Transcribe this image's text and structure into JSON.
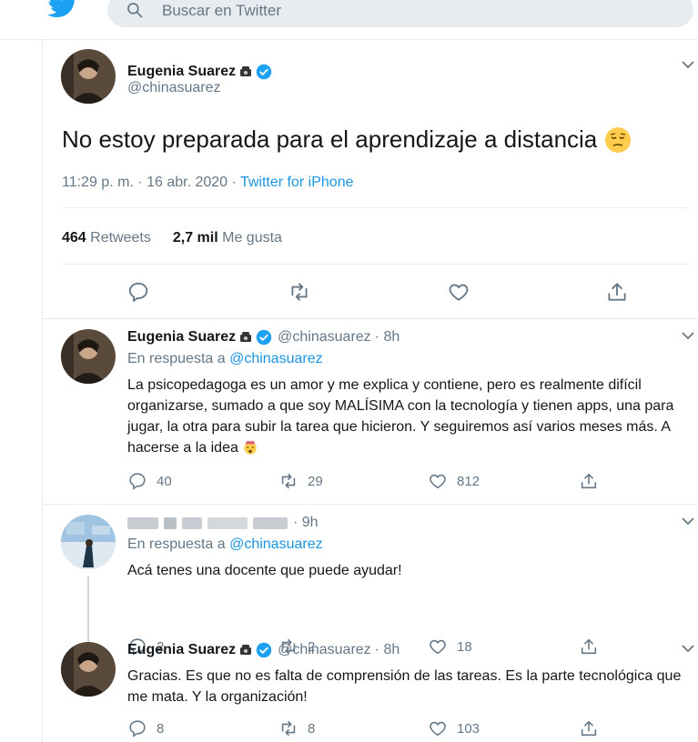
{
  "search": {
    "placeholder": "Buscar en Twitter"
  },
  "main_tweet": {
    "name": "Eugenia Suarez",
    "handle": "@chinasuarez",
    "text": "No estoy preparada para el aprendizaje a distancia",
    "emoji": "pensive-face",
    "time": "11:29 p. m. · 16 abr. 2020 ·",
    "source": "Twitter for iPhone",
    "retweets_count": "464",
    "retweets_label": "Retweets",
    "likes_count": "2,7 mil",
    "likes_label": "Me gusta"
  },
  "replies": [
    {
      "name": "Eugenia Suarez",
      "handle": "@chinasuarez",
      "time": "· 8h",
      "in_reply_prefix": "En respuesta a",
      "in_reply_mention": "@chinasuarez",
      "text": "La psicopedagoga es un amor y me explica y contiene, pero es realmente difícil organizarse, sumado a que soy MALÍSIMA con la tecnología y tienen apps, una para jugar, la otra para subir la tarea que hicieron. Y seguiremos así varios meses más. A hacerse a la idea",
      "emoji": "exploding-head",
      "replies": "40",
      "retweets": "29",
      "likes": "812"
    },
    {
      "time": "· 9h",
      "in_reply_prefix": "En respuesta a",
      "in_reply_mention": "@chinasuarez",
      "text": "Acá tenes una docente que puede ayudar!",
      "replies": "2",
      "retweets": "2",
      "likes": "18"
    },
    {
      "name": "Eugenia Suarez",
      "handle": "@chinasuarez",
      "time": "· 8h",
      "text": "Gracias. Es que no es falta de comprensión de las tareas. Es la parte tecnológica que me mata. Y la organización!",
      "replies": "8",
      "retweets": "8",
      "likes": "103"
    }
  ],
  "colors": {
    "accent": "#1da1f2",
    "link": "#1b95e0",
    "muted": "#657786",
    "border": "#e6ecf0"
  }
}
